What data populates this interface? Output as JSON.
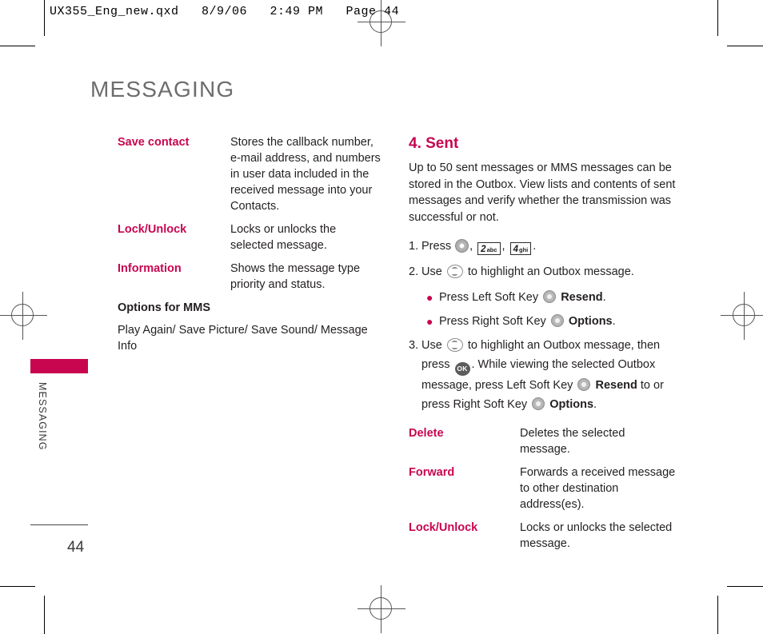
{
  "print_header": "UX355_Eng_new.qxd   8/9/06   2:49 PM   Page 44",
  "page_title": "MESSAGING",
  "side_tab_title": "MESSAGING",
  "page_number": "44",
  "accent_color": "#c8054f",
  "title_color": "#6d6d6d",
  "left_column": {
    "definitions": [
      {
        "term": "Save contact",
        "desc": "Stores the callback number, e-mail address, and numbers in user data included in the received message into your Contacts."
      },
      {
        "term": "Lock/Unlock",
        "desc": "Locks or unlocks the selected message."
      },
      {
        "term": "Information",
        "desc": "Shows the message type priority and status."
      }
    ],
    "subheading": "Options for MMS",
    "subheading_line": "Play Again/ Save Picture/ Save Sound/ Message Info"
  },
  "right_column": {
    "section_heading": "4. Sent",
    "intro_paragraph": "Up to 50 sent messages or MMS messages can be stored in the Outbox. View lists and contents of sent messages and verify whether the transmission was successful or not.",
    "steps": [
      {
        "num": "1.",
        "pre": "Press",
        "keys": [
          "menu-key",
          "2abc",
          "4ghi"
        ],
        "post": "."
      },
      {
        "num": "2.",
        "pre": "Use",
        "key": "nav-key",
        "post": "to highlight an Outbox message."
      },
      {
        "num": "3.",
        "text_a": "Use",
        "text_b": "to highlight an Outbox message, then press",
        "text_c": ". While viewing the selected Outbox message, press Left Soft Key",
        "text_d": "Resend",
        "text_e": "to or press Right Soft Key",
        "text_f": "Options",
        "text_g": "."
      }
    ],
    "bullets": [
      {
        "pre": "Press Left Soft Key",
        "bold": "Resend",
        "post": "."
      },
      {
        "pre": "Press Right Soft Key",
        "bold": "Options",
        "post": "."
      }
    ],
    "definitions": [
      {
        "term": "Delete",
        "desc": "Deletes the selected message."
      },
      {
        "term": "Forward",
        "desc": "Forwards a received message to other destination address(es)."
      },
      {
        "term": "Lock/Unlock",
        "desc": "Locks or unlocks the selected message."
      }
    ]
  },
  "keys": {
    "key2_digit": "2",
    "key2_letters": "abc",
    "key4_digit": "4",
    "key4_letters": "ghi",
    "ok_label": "OK"
  },
  "punctuation": {
    "comma": ",",
    "period": ".",
    "bullet_dot": "●"
  }
}
